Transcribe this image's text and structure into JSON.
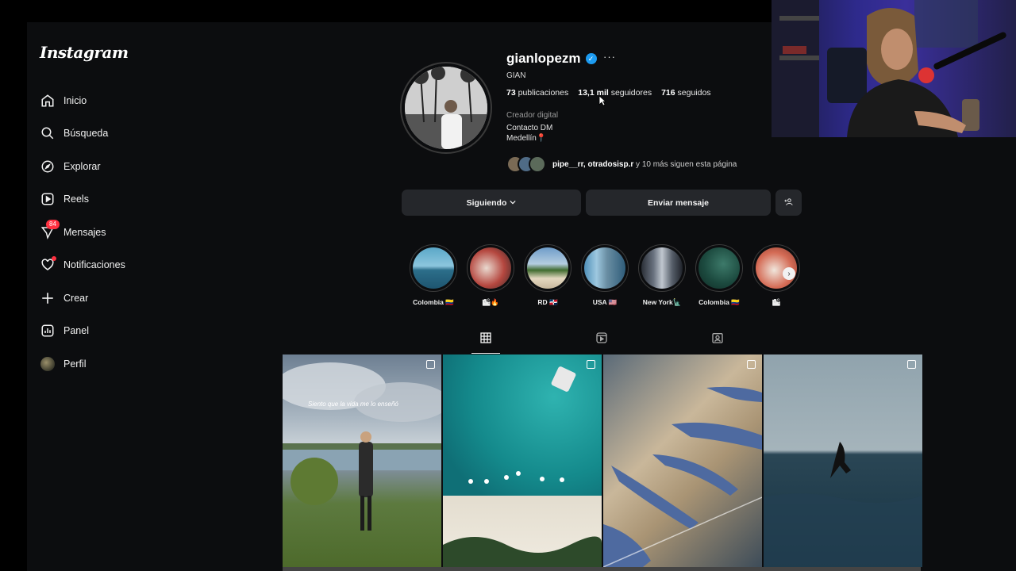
{
  "sidebar": {
    "logo": "Instagram",
    "items": [
      {
        "label": "Inicio",
        "icon": "home-icon"
      },
      {
        "label": "Búsqueda",
        "icon": "search-icon"
      },
      {
        "label": "Explorar",
        "icon": "compass-icon"
      },
      {
        "label": "Reels",
        "icon": "reels-icon"
      },
      {
        "label": "Mensajes",
        "icon": "messenger-icon",
        "badge": "84"
      },
      {
        "label": "Notificaciones",
        "icon": "heart-icon"
      },
      {
        "label": "Crear",
        "icon": "plus-icon"
      },
      {
        "label": "Panel",
        "icon": "chart-icon"
      },
      {
        "label": "Perfil",
        "icon": "avatar"
      }
    ]
  },
  "profile": {
    "username": "gianlopezm",
    "fullname": "GIAN",
    "stats": {
      "posts_value": "73",
      "posts_label": "publicaciones",
      "followers_value": "13,1 mil",
      "followers_label": "seguidores",
      "following_value": "716",
      "following_label": "seguidos"
    },
    "category": "Creador digital",
    "bio_line1": "Contacto DM",
    "bio_line2": "Medellín📍",
    "followed_by_names": "pipe__rr, otradosisp.r",
    "followed_by_rest": "y 10 más siguen esta página"
  },
  "actions": {
    "following_label": "Siguiendo",
    "message_label": "Enviar mensaje",
    "suggest_icon": "add-person-icon"
  },
  "highlights": [
    {
      "label": "Colombia 🇨🇴"
    },
    {
      "label": "🏙🔥"
    },
    {
      "label": "RD 🇩🇴"
    },
    {
      "label": "USA 🇺🇸"
    },
    {
      "label": "New York🗽"
    },
    {
      "label": "Colombia 🇨🇴"
    },
    {
      "label": "🏙"
    }
  ],
  "tabs": [
    "posts-tab",
    "reels-tab",
    "tagged-tab"
  ],
  "posts": [
    {
      "caption": "Siento que la vida me lo enseñó"
    }
  ],
  "colors": {
    "background": "#0c0d0f",
    "button": "#25272b",
    "verified": "#1d9bf0",
    "badge": "#ff3040"
  }
}
